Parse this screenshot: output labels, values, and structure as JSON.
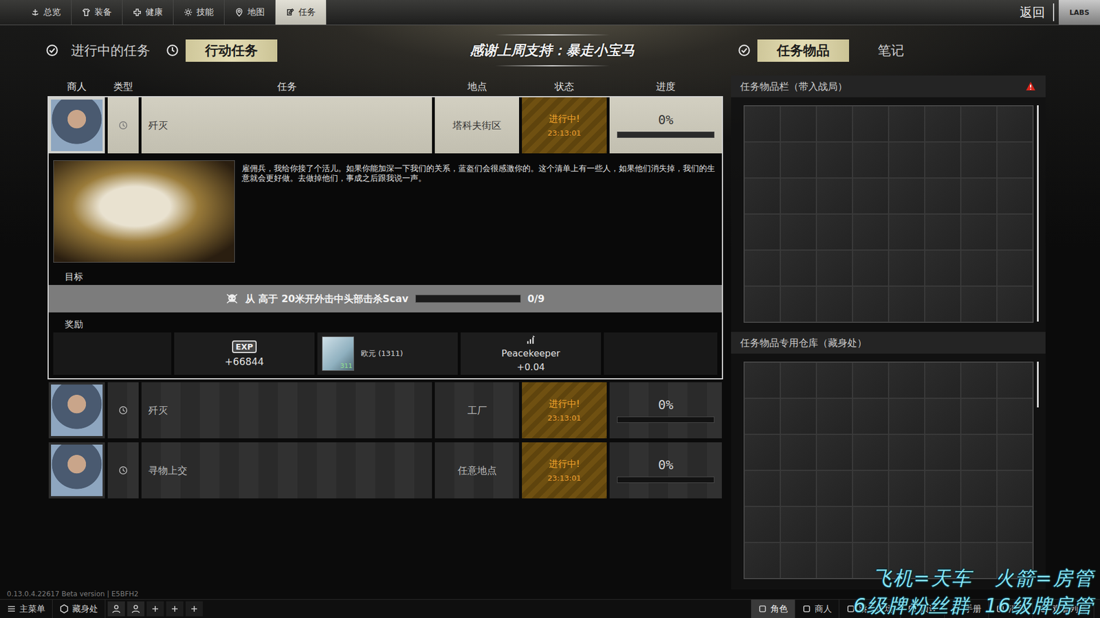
{
  "nav": {
    "tabs": [
      {
        "label": "总览",
        "selected": false
      },
      {
        "label": "装备",
        "selected": false
      },
      {
        "label": "健康",
        "selected": false
      },
      {
        "label": "技能",
        "selected": false
      },
      {
        "label": "地图",
        "selected": false
      },
      {
        "label": "任务",
        "selected": true
      }
    ],
    "back": "返回",
    "logo": "LABS"
  },
  "subnav": {
    "left": [
      {
        "label": "进行中的任务",
        "selected": false
      },
      {
        "label": "行动任务",
        "selected": true
      }
    ],
    "banner": "感谢上周支持：暴走小宝马",
    "right": [
      {
        "label": "任务物品",
        "selected": true
      },
      {
        "label": "笔记",
        "selected": false
      }
    ]
  },
  "tasks": {
    "columns": [
      "商人",
      "类型",
      "任务",
      "地点",
      "状态",
      "进度"
    ],
    "rows": [
      {
        "task": "歼灭",
        "location": "塔科夫街区",
        "status": "进行中!",
        "time": "23:13:01",
        "progress": "0%",
        "level": 0,
        "expanded": true
      },
      {
        "task": "歼灭",
        "location": "工厂",
        "status": "进行中!",
        "time": "23:13:01",
        "progress": "0%",
        "level": 0,
        "expanded": false
      },
      {
        "task": "寻物上交",
        "location": "任意地点",
        "status": "进行中!",
        "time": "23:13:01",
        "progress": "0%",
        "level": 0,
        "expanded": false
      }
    ]
  },
  "details": {
    "description": "雇佣兵，我给你接了个活儿。如果你能加深一下我们的关系，蓝盔们会很感激你的。这个清单上有一些人，如果他们消失掉，我们的生意就会更好做。去做掉他们，事成之后跟我说一声。",
    "objective_label": "目标",
    "objective": {
      "text": "从 高于 20米开外击中头部击杀Scav",
      "count": "0/9",
      "level": 0
    },
    "reward_label": "奖励",
    "rewards": [
      {
        "kind": "empty"
      },
      {
        "kind": "exp",
        "badge": "EXP",
        "value": "+66844"
      },
      {
        "kind": "item",
        "label": "欧元 (1311)",
        "badge": "311"
      },
      {
        "kind": "standing",
        "name": "Peacekeeper",
        "value": "+0.04"
      },
      {
        "kind": "empty"
      }
    ]
  },
  "stash": {
    "panels": [
      {
        "title": "任务物品栏（带入战局）",
        "warning": true
      },
      {
        "title": "任务物品专用仓库（藏身处）",
        "warning": false
      }
    ]
  },
  "version": "0.13.0.4.22617 Beta version | E5BFH2",
  "bottom_bar": {
    "left": [
      "主菜单",
      "藏身处"
    ],
    "right": [
      {
        "label": "角色",
        "selected": true
      },
      {
        "label": "商人",
        "selected": false
      },
      {
        "label": "跳蚤市场",
        "selected": false
      },
      {
        "label": "预设",
        "selected": false
      },
      {
        "label": "手册",
        "selected": false
      },
      {
        "label": "消息",
        "selected": false
      },
      {
        "label": "观看列表",
        "selected": false
      }
    ]
  },
  "overlay": [
    "飞机=天车   火箭=房管",
    "6级牌粉丝群  16级牌房管"
  ]
}
